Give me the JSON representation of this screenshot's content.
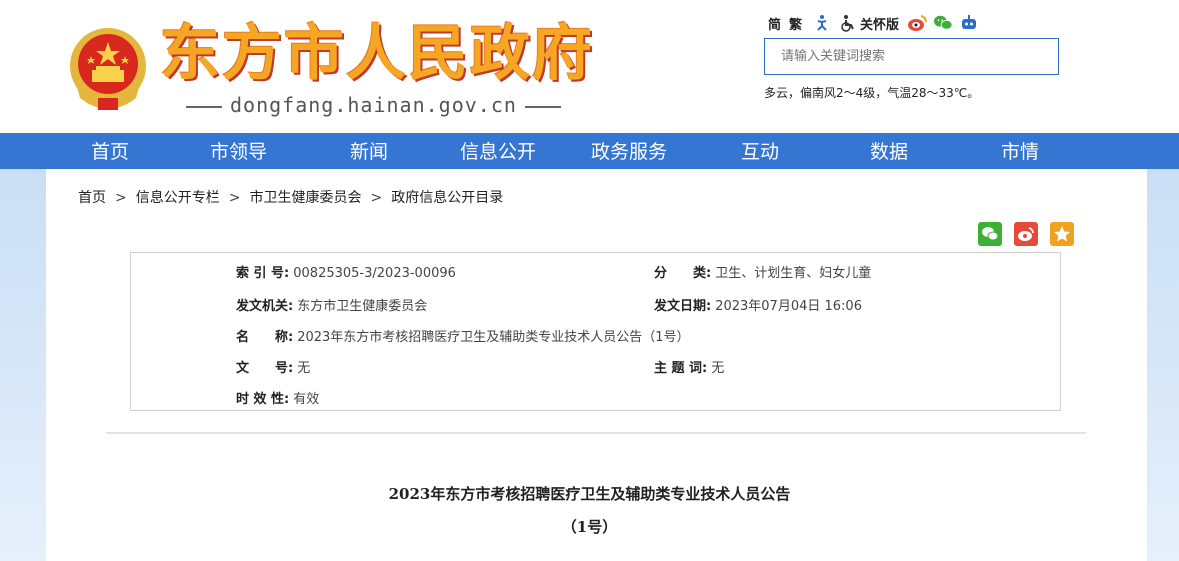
{
  "header": {
    "site_title": "东方市人民政府",
    "site_domain": "dongfang.hainan.gov.cn",
    "toolbar": {
      "simplified": "简",
      "traditional": "繁",
      "elder_mode": "关怀版"
    },
    "search_placeholder": "请输入关键词搜索",
    "weather": "多云，偏南风2～4级，气温28～33℃。"
  },
  "nav": {
    "items": [
      "首页",
      "市领导",
      "新闻",
      "信息公开",
      "政务服务",
      "互动",
      "数据",
      "市情"
    ]
  },
  "breadcrumb": {
    "items": [
      "首页",
      "信息公开专栏",
      "市卫生健康委员会",
      "政府信息公开目录"
    ],
    "separator": ">"
  },
  "meta": {
    "index_label": "索 引 号:",
    "index_value": "00825305-3/2023-00096",
    "category_label": "分　　类:",
    "category_value": "卫生、计划生育、妇女儿童",
    "issuer_label": "发文机关:",
    "issuer_value": "东方市卫生健康委员会",
    "date_label": "发文日期:",
    "date_value": "2023年07月04日 16:06",
    "name_label": "名　　称:",
    "name_value": "2023年东方市考核招聘医疗卫生及辅助类专业技术人员公告（1号）",
    "docno_label": "文　　号:",
    "docno_value": "无",
    "topic_label": "主 题 词:",
    "topic_value": "无",
    "validity_label": "时 效 性:",
    "validity_value": "有效"
  },
  "document": {
    "title": "2023年东方市考核招聘医疗卫生及辅助类专业技术人员公告",
    "subtitle": "（1号）"
  },
  "colors": {
    "nav_bg": "#3476d2",
    "title_orange": "#f5a623",
    "wechat": "#3cb035",
    "weibo": "#e64a3b",
    "favorite": "#f0a21f"
  }
}
